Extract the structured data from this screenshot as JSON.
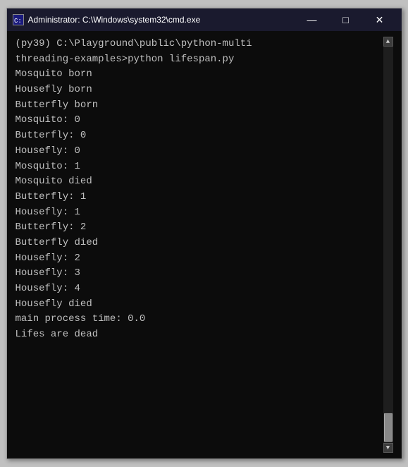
{
  "window": {
    "title": "Administrator: C:\\Windows\\system32\\cmd.exe",
    "icon_label": "C:"
  },
  "controls": {
    "minimize": "—",
    "maximize": "□",
    "close": "✕"
  },
  "console": {
    "lines": [
      "(py39) C:\\Playground\\public\\python-multi",
      "threading-examples>python lifespan.py",
      "Mosquito born",
      "Housefly born",
      "Butterfly born",
      "Mosquito: 0",
      "Butterfly: 0",
      "Housefly: 0",
      "Mosquito: 1",
      "Mosquito died",
      "Butterfly: 1",
      "Housefly: 1",
      "Butterfly: 2",
      "Butterfly died",
      "Housefly: 2",
      "Housefly: 3",
      "Housefly: 4",
      "Housefly died",
      "main process time: 0.0",
      "Lifes are dead"
    ]
  }
}
